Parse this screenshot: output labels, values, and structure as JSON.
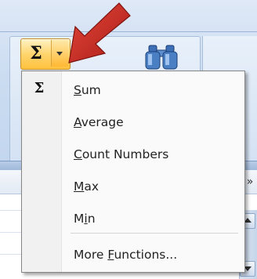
{
  "autosum": {
    "sigma": "Σ",
    "dropdown_icon": "chevron-down-icon"
  },
  "ribbon": {
    "find_icon": "binoculars-icon",
    "expand_icon": "double-chevron-down-icon",
    "expand_glyph": "»"
  },
  "annotation": {
    "arrow_color": "#c8281f"
  },
  "menu": {
    "gutter_icon": "Σ",
    "items": [
      {
        "label": "Sum",
        "accel": "S",
        "rest": "um"
      },
      {
        "label": "Average",
        "accel": "A",
        "rest": "verage"
      },
      {
        "label": "Count Numbers",
        "accel": "C",
        "rest": "ount Numbers"
      },
      {
        "label": "Max",
        "accel": "M",
        "rest": "ax"
      },
      {
        "label": "Min",
        "pre": "M",
        "accel": "i",
        "rest": "n"
      },
      {
        "label": "More Functions...",
        "pre": "More ",
        "accel": "F",
        "rest": "unctions..."
      }
    ]
  }
}
